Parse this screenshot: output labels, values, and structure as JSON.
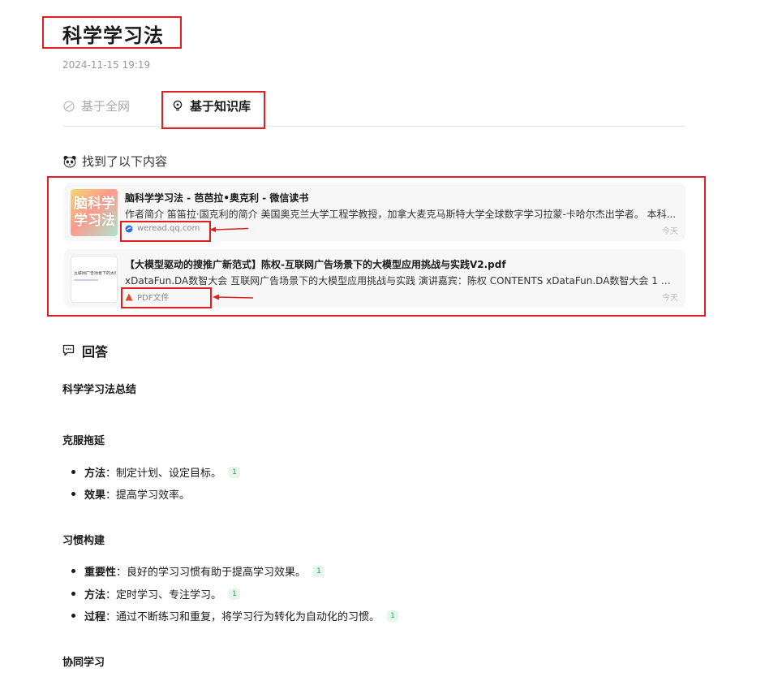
{
  "page": {
    "title": "科学学习法",
    "date": "2024-11-15 19:19"
  },
  "tabs": [
    {
      "label": "基于全网",
      "icon": "web-icon",
      "active": false
    },
    {
      "label": "基于知识库",
      "icon": "bulb-icon",
      "active": true
    }
  ],
  "found": {
    "label": "找到了以下内容",
    "icon": "panda-icon"
  },
  "results": [
    {
      "thumb_text": "脑科学学习法",
      "title": "脑科学学习法 - 芭芭拉•奥克利 - 微信读书",
      "snippet": "作者简介 笛笛拉·国克利的简介 美国奥克兰大学工程学教授，加拿大麦克马斯特大学全球数字学习拉蒙-卡哈尔杰出学者。 本科...",
      "source": "weread.qq.com",
      "source_icon": "weread-icon",
      "time": "今天"
    },
    {
      "thumb_text": "互联网广告场景下的大模",
      "title": "【大模型驱动的搜推广新范式】陈权-互联网广告场景下的大模型应用挑战与实践V2.pdf",
      "snippet": "xDataFun.DA数智大会 互联网广告场景下的大模型应用挑战与实践 演讲嘉宾：陈权 CONTENTS xDataFun.DA数智大会 1 内容...",
      "source": "PDF文件",
      "source_icon": "pdf-icon",
      "time": "今天"
    }
  ],
  "answer": {
    "label": "回答",
    "icon": "chat-icon",
    "summary": "科学学习法总结",
    "sections": [
      {
        "heading": "克服拖延",
        "items": [
          {
            "term": "方法",
            "text": "：制定计划、设定目标。",
            "cite": "1"
          },
          {
            "term": "效果",
            "text": "：提高学习效率。",
            "cite": ""
          }
        ]
      },
      {
        "heading": "习惯构建",
        "items": [
          {
            "term": "重要性",
            "text": "：良好的学习习惯有助于提高学习效果。",
            "cite": "1"
          },
          {
            "term": "方法",
            "text": "：定时学习、专注学习。",
            "cite": "1"
          },
          {
            "term": "过程",
            "text": "：通过不断练习和重复，将学习行为转化为自动化的习惯。",
            "cite": "1"
          }
        ]
      },
      {
        "heading": "协同学习",
        "items": []
      }
    ]
  },
  "colors": {
    "annotation": "#e02020",
    "cite_bg": "#e7f6ec",
    "cite_fg": "#2f9e5a",
    "card_bg": "#f7f7f8"
  }
}
